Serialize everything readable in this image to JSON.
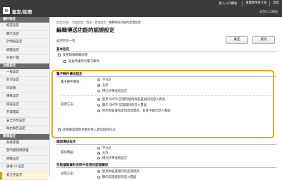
{
  "topbar": {
    "title": "設定/註冊",
    "links": [
      "登入入口網站",
      "遠端使用者介面",
      "登出"
    ],
    "return_link": "返回入口網站"
  },
  "sidebar": {
    "sections": [
      {
        "heading": "偏好設定",
        "items": [
          "紙張設定",
          "顯示設定",
          "計時器設定",
          "網路設定",
          "外部介面"
        ]
      },
      {
        "heading": "功能設定",
        "items": [
          "一般設定",
          "影印設定",
          "印表機",
          "傳真設定",
          "掃描設定",
          "存取檔案",
          "安全列印設定",
          "輸出報告設定"
        ]
      },
      {
        "heading": "管理設定",
        "items": [
          "系統管理",
          "部門識別碼管理",
          "網路設定",
          "遠端 UI 設定",
          "安全性設定"
        ]
      }
    ],
    "active_item": "安全性設定"
  },
  "main": {
    "breadcrumb": [
      "設定/註冊",
      "功能設定",
      "傳送",
      "掃描設定",
      "編輯傳送功能的認證設定"
    ],
    "title": "編輯傳送功能的認證設定",
    "back_label": "返回至前一頁",
    "ok_label": "確定",
    "cancel_label": "取消",
    "basic": {
      "heading": "基本設定",
      "opt1": "使用無線網路認證",
      "opt2": "因此時讓所有電子郵件"
    },
    "email": {
      "heading": "電子郵件傳送設定",
      "row1_label": "電子郵件傳送：",
      "row1_options": [
        "不允許",
        "允許",
        "僅允許傳送給自己"
      ],
      "row2_label": "認證方法：",
      "row2_options": [
        "使用 SMTP 認證時使用與裝置相同的登入資訊",
        "顯示 SMTP 認證資訊的登入畫面",
        "使用為裝置指定的認證資訊，並且不顯示登入畫面"
      ],
      "option3": "從網路認證使用者的登入資訊取得位址"
    },
    "fax": {
      "heading": "檔案傳送設定",
      "row_label": "檔案傳送：",
      "row_options": [
        "不允許",
        "允許",
        "僅允許傳送給自己"
      ]
    },
    "proxy": {
      "heading": "存取檔案資料夾時中註冊的認證資訊",
      "row_label": "認證方法：",
      "row_options": [
        "使用與裝置相同的認證資訊",
        "顯示認證資訊的登入畫面"
      ]
    }
  },
  "colors": {
    "topbar_bg": "#3a3a3a",
    "sidebar_head_bg": "#6a6a6a",
    "highlight_border": "#f0a800",
    "active_item_accent": "#d4a017"
  }
}
